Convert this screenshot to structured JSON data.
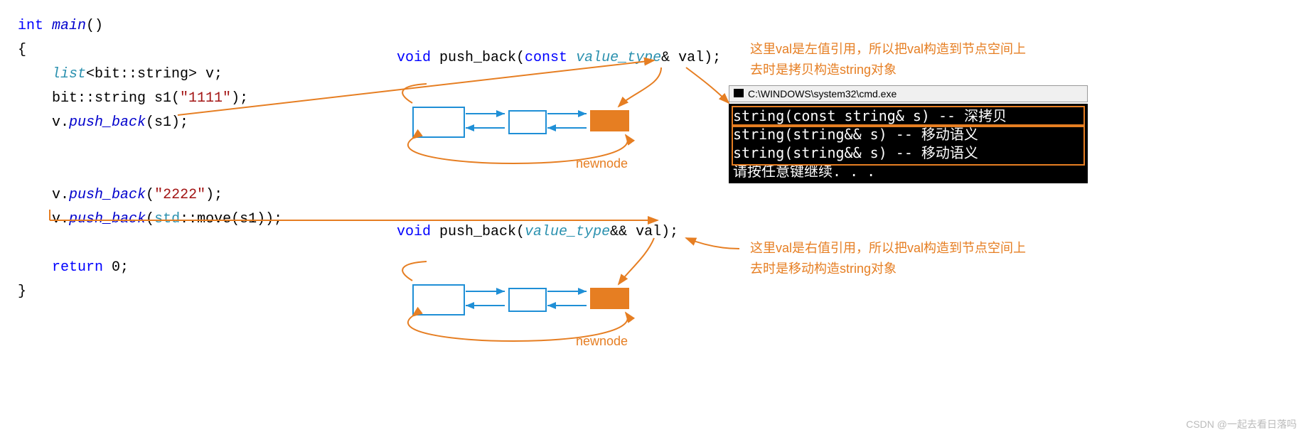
{
  "code": {
    "lines": [
      {
        "tokens": [
          {
            "t": "int ",
            "c": "kw"
          },
          {
            "t": "main",
            "c": "fn"
          },
          {
            "t": "()",
            "c": "op"
          }
        ]
      },
      {
        "tokens": [
          {
            "t": "{",
            "c": "op"
          }
        ]
      },
      {
        "tokens": [
          {
            "t": "    ",
            "c": "op"
          },
          {
            "t": "list",
            "c": "ty"
          },
          {
            "t": "<bit::string> v;",
            "c": "op"
          }
        ]
      },
      {
        "tokens": [
          {
            "t": "    bit::string s1(",
            "c": "op"
          },
          {
            "t": "\"1111\"",
            "c": "str"
          },
          {
            "t": ");",
            "c": "op"
          }
        ]
      },
      {
        "tokens": [
          {
            "t": "    v.",
            "c": "op"
          },
          {
            "t": "push_back",
            "c": "fn"
          },
          {
            "t": "(s1);",
            "c": "op"
          }
        ]
      },
      {
        "tokens": [
          {
            "t": "",
            "c": "op"
          }
        ]
      },
      {
        "tokens": [
          {
            "t": "",
            "c": "op"
          }
        ]
      },
      {
        "tokens": [
          {
            "t": "    v.",
            "c": "op"
          },
          {
            "t": "push_back",
            "c": "fn"
          },
          {
            "t": "(",
            "c": "op"
          },
          {
            "t": "\"2222\"",
            "c": "str"
          },
          {
            "t": ");",
            "c": "op"
          }
        ]
      },
      {
        "tokens": [
          {
            "t": "    v.",
            "c": "op"
          },
          {
            "t": "push_back",
            "c": "fn"
          },
          {
            "t": "(",
            "c": "op"
          },
          {
            "t": "std",
            "c": "ns"
          },
          {
            "t": "::move(s1));",
            "c": "op"
          }
        ]
      },
      {
        "tokens": [
          {
            "t": "",
            "c": "op"
          }
        ]
      },
      {
        "tokens": [
          {
            "t": "    ",
            "c": "op"
          },
          {
            "t": "return",
            "c": "kw"
          },
          {
            "t": " 0;",
            "c": "op"
          }
        ]
      },
      {
        "tokens": [
          {
            "t": "}",
            "c": "op"
          }
        ]
      }
    ]
  },
  "signature1": {
    "tokens": [
      {
        "t": "void",
        "c": "kw"
      },
      {
        "t": " push_back(",
        "c": "op"
      },
      {
        "t": "const",
        "c": "kw"
      },
      {
        "t": " ",
        "c": "op"
      },
      {
        "t": "value_type",
        "c": "ty"
      },
      {
        "t": "& val);",
        "c": "op"
      }
    ]
  },
  "signature2": {
    "tokens": [
      {
        "t": "void",
        "c": "kw"
      },
      {
        "t": " push_back(",
        "c": "op"
      },
      {
        "t": "value_type",
        "c": "ty"
      },
      {
        "t": "&& val);",
        "c": "op"
      }
    ]
  },
  "annotation1": "这里val是左值引用，所以把val构造到节点空间上\n去时是拷贝构造string对象",
  "annotation2": "这里val是右值引用，所以把val构造到节点空间上\n去时是移动构造string对象",
  "newnode_label": "newnode",
  "console": {
    "title": "C:\\WINDOWS\\system32\\cmd.exe",
    "lines": [
      "string(const string& s) -- 深拷贝",
      "string(string&& s) -- 移动语义",
      "string(string&& s) -- 移动语义",
      "请按任意键继续. . ."
    ]
  },
  "watermark": "CSDN @一起去看日落吗"
}
